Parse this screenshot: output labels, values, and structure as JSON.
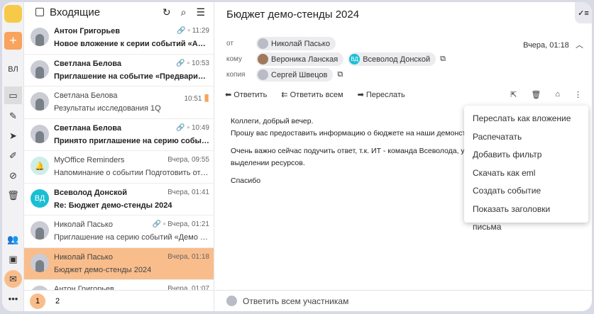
{
  "rail": {
    "user_initials": "ВЛ",
    "compose_icon": "plus-icon",
    "accent": "#f9a35c"
  },
  "list": {
    "title": "Входящие",
    "items": [
      {
        "name": "Антон Григорьев",
        "subject": "Новое вложение к серии событий «Аналити...",
        "time": "11:29",
        "unread": true,
        "attach": true
      },
      {
        "name": "Светлана Белова",
        "subject": "Приглашение на событие «Предварительно...",
        "time": "10:53",
        "unread": true,
        "attach": true
      },
      {
        "name": "Светлана Белова",
        "subject": "Результаты исследования 1Q",
        "time": "10:51",
        "unread": false,
        "flag": true
      },
      {
        "name": "Светлана Белова",
        "subject": "Принято приглашение на серию событий «...",
        "time": "10:49",
        "unread": true,
        "attach": true
      },
      {
        "name": "MyOffice Reminders",
        "subject": "Напоминание о событии Подготовить отчет...",
        "time": "Вчера, 09:55",
        "unread": false
      },
      {
        "name": "Всеволод Донской",
        "initials": "ВД",
        "subject": "Re: Бюджет демо-стенды 2024",
        "time": "Вчера, 01:41",
        "unread": true
      },
      {
        "name": "Николай Пасько",
        "subject": "Приглашение на серию событий «Демо стен...",
        "time": "Вчера, 01:21",
        "unread": false,
        "attach": true
      },
      {
        "name": "Николай Пасько",
        "subject": "Бюджет демо-стенды 2024",
        "time": "Вчера, 01:18",
        "unread": false,
        "selected": true
      },
      {
        "name": "Антон Григорьев",
        "subject": "",
        "time": "Вчера, 01:07",
        "unread": false
      }
    ],
    "pages": [
      "1",
      "2"
    ]
  },
  "message": {
    "subject": "Бюджет демо-стенды 2024",
    "from_label": "от",
    "from": "Николай Пасько",
    "date": "Вчера, 01:18",
    "to_label": "кому",
    "to": [
      "Вероника Ланская",
      "Всеволод Донской"
    ],
    "to_initials": "ВД",
    "cc_label": "копия",
    "cc": "Сергей Швецов",
    "actions": {
      "reply": "Ответить",
      "reply_all": "Ответить всем",
      "forward": "Переслать"
    },
    "body": [
      "Коллеги, добрый вечер.",
      "Прошу вас предоставить информацию о бюджете на наши демонстрац",
      "Очень важно сейчас подучить ответ, т.к. ИТ - команда Всеволода, уже",
      "выделении ресурсов.",
      "Спасибо"
    ],
    "reply_placeholder": "Ответить всем участникам"
  },
  "menu": [
    "Переслать как вложение",
    "Распечатать",
    "Добавить фильтр",
    "Скачать как eml",
    "Создать событие",
    "Показать заголовки письма"
  ]
}
